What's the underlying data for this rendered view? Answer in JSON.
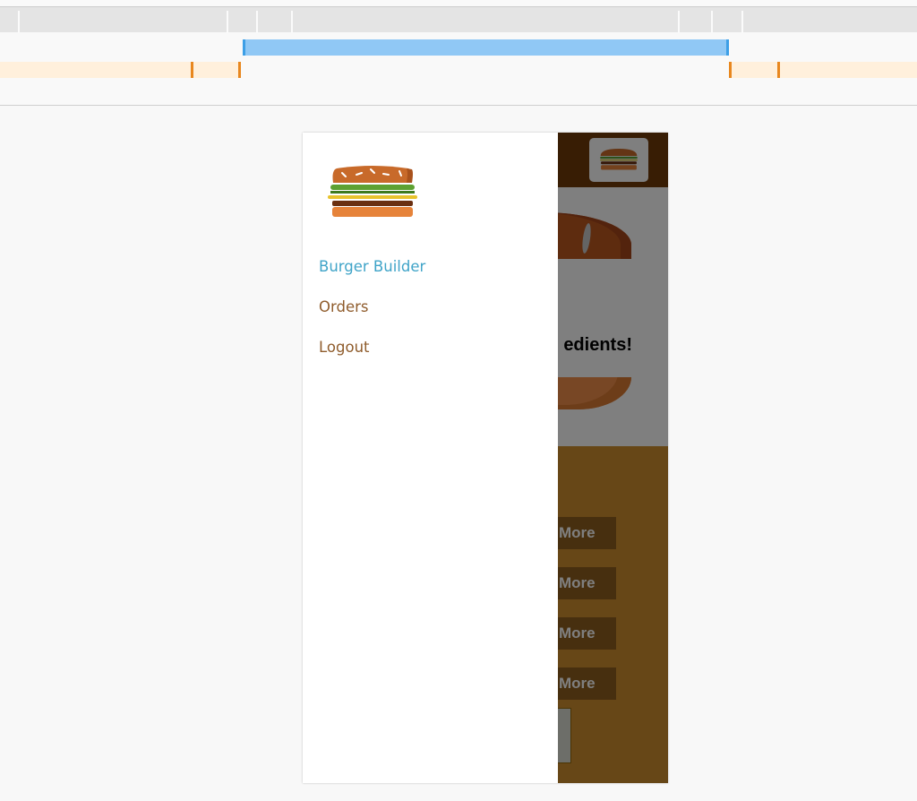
{
  "drawer": {
    "nav_items": [
      {
        "label": "Burger Builder",
        "active": true
      },
      {
        "label": "Orders",
        "active": false
      },
      {
        "label": "Logout",
        "active": false
      }
    ]
  },
  "app": {
    "message": "edients!",
    "controls": [
      {
        "more_label": "More"
      },
      {
        "more_label": "More"
      },
      {
        "more_label": "More"
      },
      {
        "more_label": "More"
      }
    ]
  },
  "colors": {
    "header": "#703b09",
    "nav_active": "#40a4c8",
    "nav_default": "#8f5c2c",
    "controls_bg": "#cf8f2e",
    "more_button": "#8f5e1e"
  }
}
